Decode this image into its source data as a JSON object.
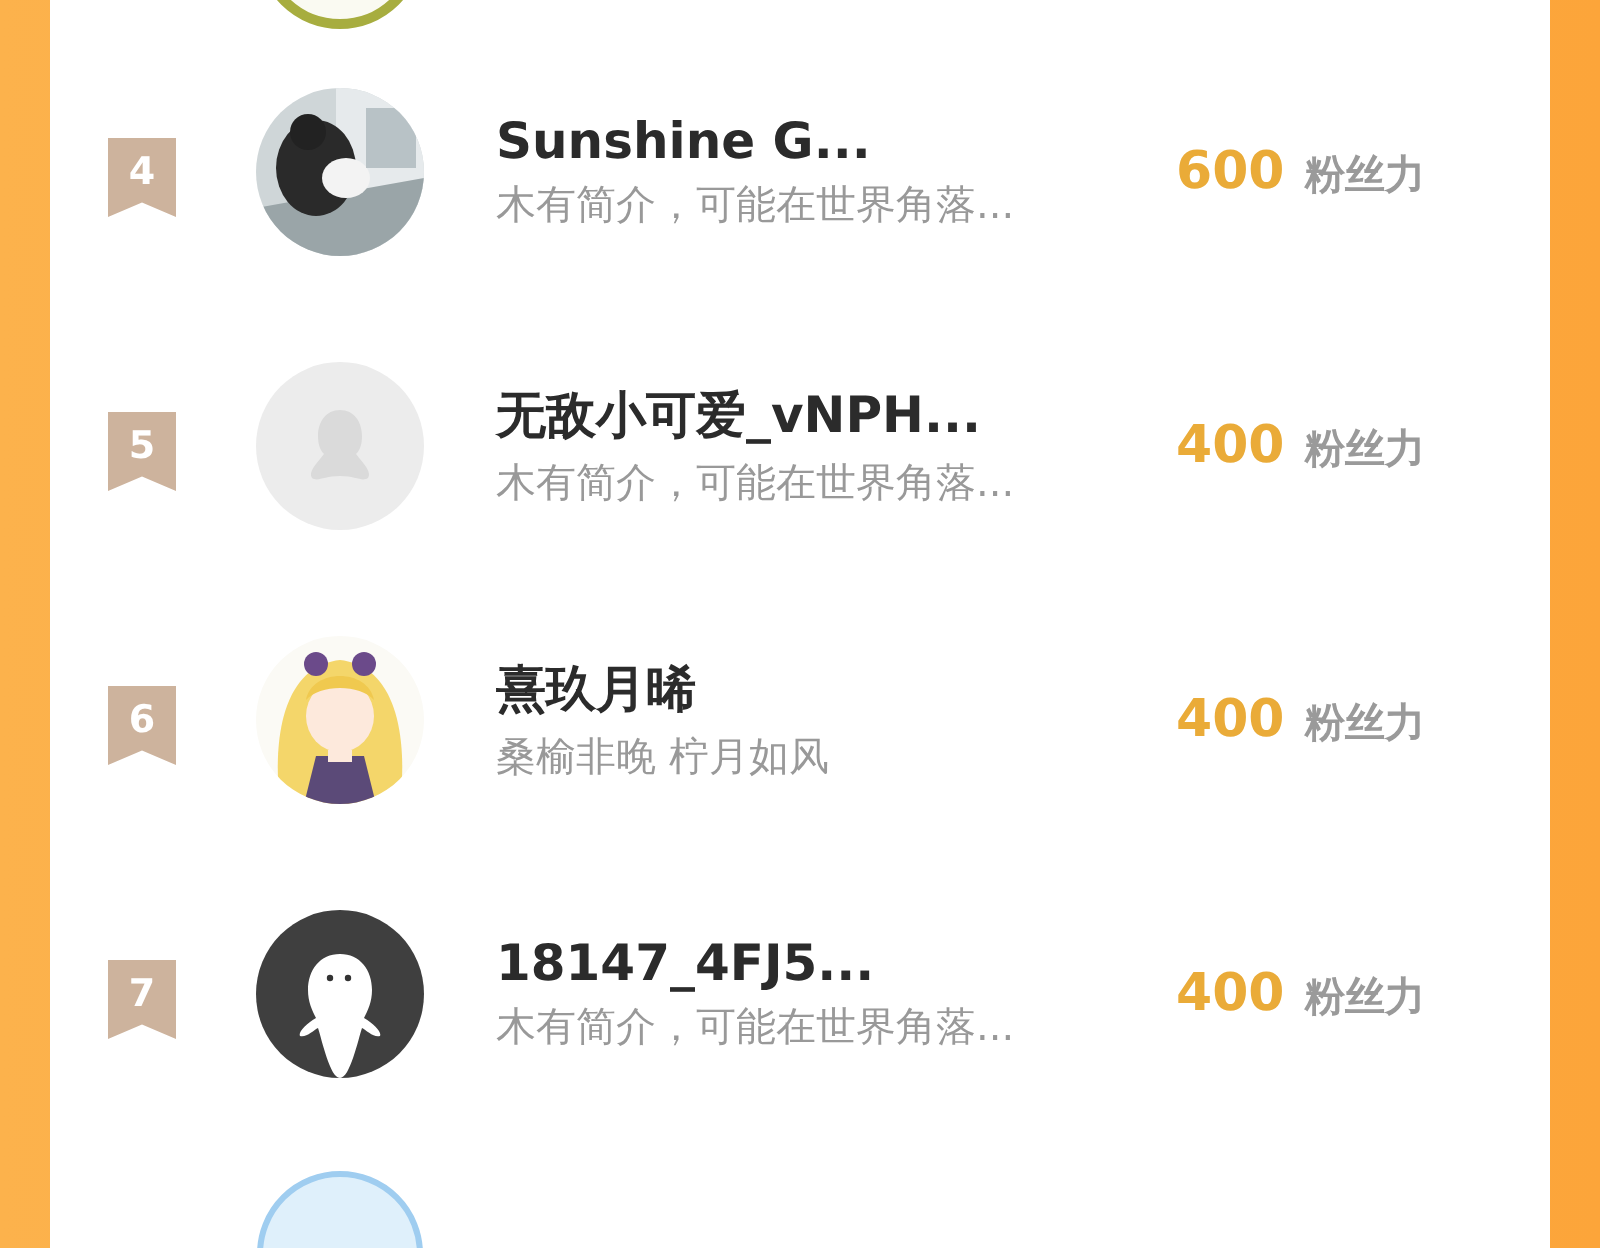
{
  "rows": [
    {
      "rank": "4",
      "name": "Sunshine G...",
      "bio": "木有简介，可能在世界角落...",
      "fans": "600",
      "fans_label": "粉丝力"
    },
    {
      "rank": "5",
      "avatar": {
        "kind": "default"
      },
      "name": "无敌小可爱_vNPH...",
      "bio": "木有简介，可能在世界角落...",
      "fans": "400",
      "fans_label": "粉丝力"
    },
    {
      "rank": "6",
      "name": "熹玖月晞",
      "bio": "桑榆非晚 柠月如风",
      "fans": "400",
      "fans_label": "粉丝力"
    },
    {
      "rank": "7",
      "avatar": {
        "kind": "ghost"
      },
      "name": "18147_4FJ5...",
      "bio": "木有简介，可能在世界角落...",
      "fans": "400",
      "fans_label": "粉丝力"
    }
  ]
}
